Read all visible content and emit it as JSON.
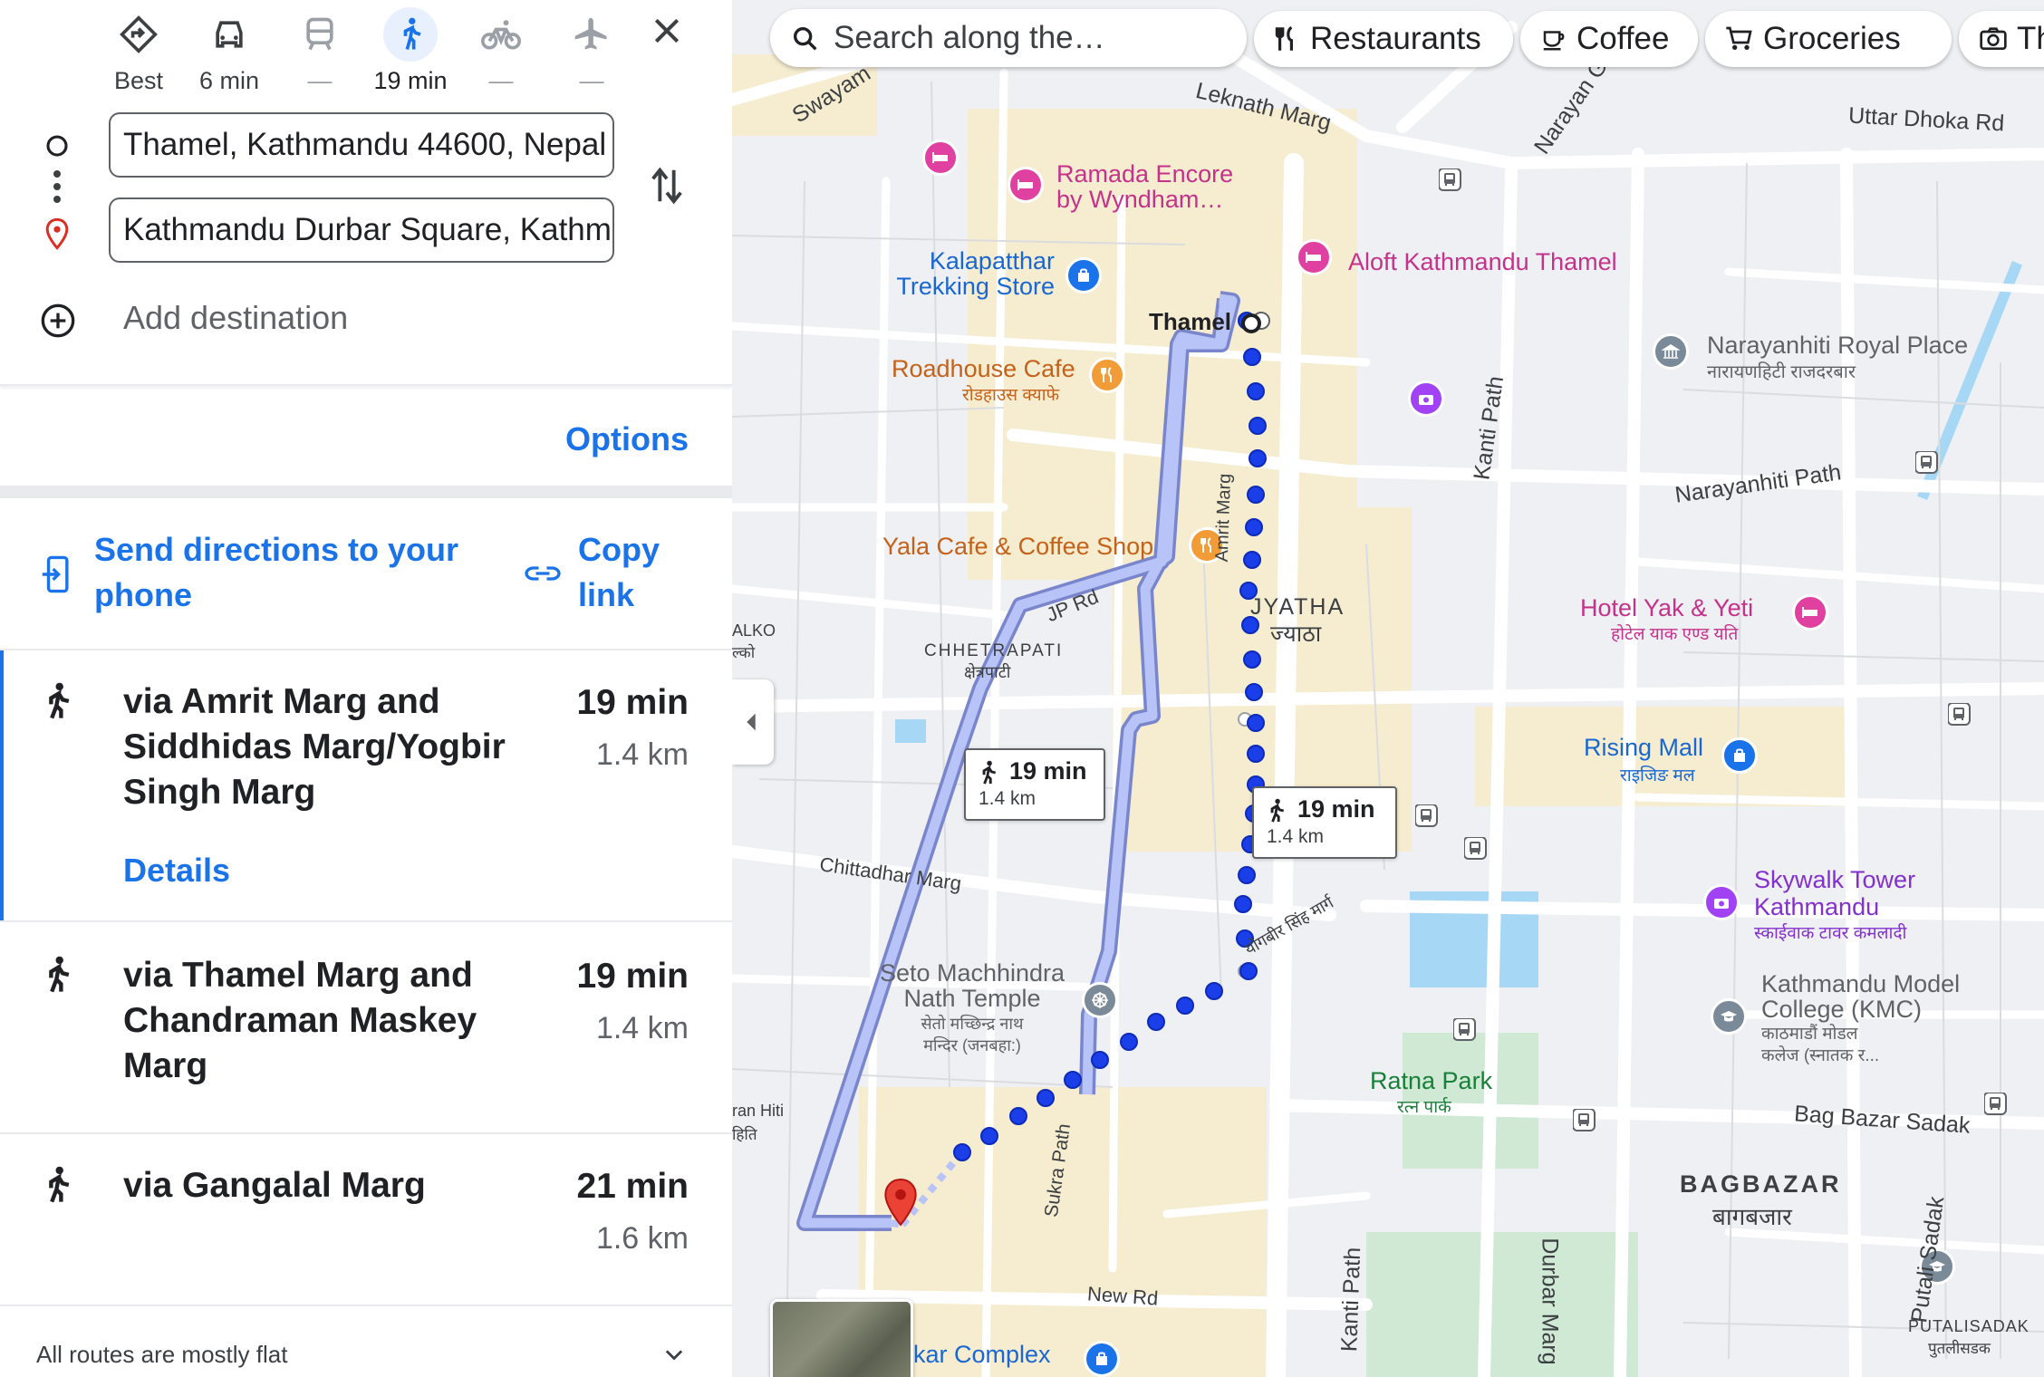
{
  "modes": [
    {
      "label": "Best",
      "icon": "best-route-icon"
    },
    {
      "label": "6 min",
      "icon": "car-icon"
    },
    {
      "label": "—",
      "icon": "train-icon"
    },
    {
      "label": "19 min",
      "icon": "walk-icon"
    },
    {
      "label": "—",
      "icon": "bike-icon"
    },
    {
      "label": "—",
      "icon": "flight-icon"
    }
  ],
  "origin": "Thamel, Kathmandu 44600, Nepal",
  "destination": "Kathmandu Durbar Square, Kathmandu",
  "add_destination": "Add destination",
  "options_label": "Options",
  "send_directions": "Send directions to your phone",
  "copy_link": "Copy link",
  "routes": [
    {
      "title": "via Amrit Marg and Siddhidas Marg/Yogbir Singh Marg",
      "time": "19 min",
      "distance": "1.4 km",
      "details": "Details"
    },
    {
      "title": "via Thamel Marg and Chandraman Maskey Marg",
      "time": "19 min",
      "distance": "1.4 km"
    },
    {
      "title": "via Gangalal Marg",
      "time": "21 min",
      "distance": "1.6 km"
    }
  ],
  "footer_note": "All routes are mostly flat",
  "map": {
    "search_placeholder": "Search along the…",
    "chips": [
      "Restaurants",
      "Coffee",
      "Groceries",
      "Thi"
    ],
    "bubble1": {
      "time": "19 min",
      "distance": "1.4 km"
    },
    "bubble2": {
      "time": "19 min",
      "distance": "1.4 km"
    },
    "origin_label": "Thamel",
    "places": {
      "ramada1": "Ramada Encore",
      "ramada2": "by Wyndham…",
      "aloft": "Aloft Kathmandu Thamel",
      "kala1": "Kalapatthar",
      "kala2": "Trekking Store",
      "roadhouse": "Roadhouse Cafe",
      "roadhouse_np": "रोडहाउस क्याफे",
      "yala": "Yala Cafe & Coffee Shop",
      "narayanhiti": "Narayanhiti Royal Place",
      "narayanhiti_np": "नारायणहिटी राजदरबार",
      "yak": "Hotel Yak & Yeti",
      "yak_np": "होटेल याक एण्ड यति",
      "rising": "Rising Mall",
      "rising_np": "राइजिङ मल",
      "skywalk1": "Skywalk Tower",
      "skywalk2": "Kathmandu",
      "skywalk_np": "स्काईवाक टावर कमलादी",
      "kmc1": "Kathmandu Model",
      "kmc2": "College (KMC)",
      "kmc_np1": "काठमाडौं मोडल",
      "kmc_np2": "कलेज (स्नातक र...",
      "seto1": "Seto Machhindra",
      "seto2": "Nath Temple",
      "seto_np1": "सेतो मच्छिन्द्र नाथ",
      "seto_np2": "मन्दिर (जनबहा:)",
      "ratna": "Ratna Park",
      "ratna_np": "रत्न पार्क",
      "kar": "kar Complex"
    },
    "areas": {
      "jyatha": "JYATHA",
      "jyatha_np": "ज्याठा",
      "chhetrapati": "CHHETRAPATI",
      "chhetrapati_np": "क्षेत्रपाटी",
      "bagbazar": "BAGBAZAR",
      "bagbazar_np": "बागबजार",
      "putalisadak": "PUTALISADAK",
      "putalisadak_np": "पुतलीसडक",
      "alko": "ALKO",
      "alko_np": "ल्को",
      "hiti": "ran Hiti",
      "hiti_np": "हिति"
    },
    "streets": {
      "swayambhu": "Swayam",
      "leknath": "Leknath Marg",
      "narayan_gopal": "Narayan Gop",
      "uttar_dhoka": "Uttar Dhoka Rd",
      "kanti_path": "Kanti Path",
      "narayanhiti_path": "Narayanhiti Path",
      "amrit_marg": "Amrit Marg",
      "jp_rd": "JP Rd",
      "chittadhar": "Chittadhar Marg",
      "yogbir": "योगबीर सिंह मार्ग",
      "sukra_path": "Sukra Path",
      "new_rd": "New Rd",
      "bag_bazar_sadak": "Bag Bazar Sadak",
      "kanti_path2": "Kanti Path",
      "durbar_marg": "Durbar Marg",
      "putali_sadak": "Putali Sadak"
    }
  }
}
